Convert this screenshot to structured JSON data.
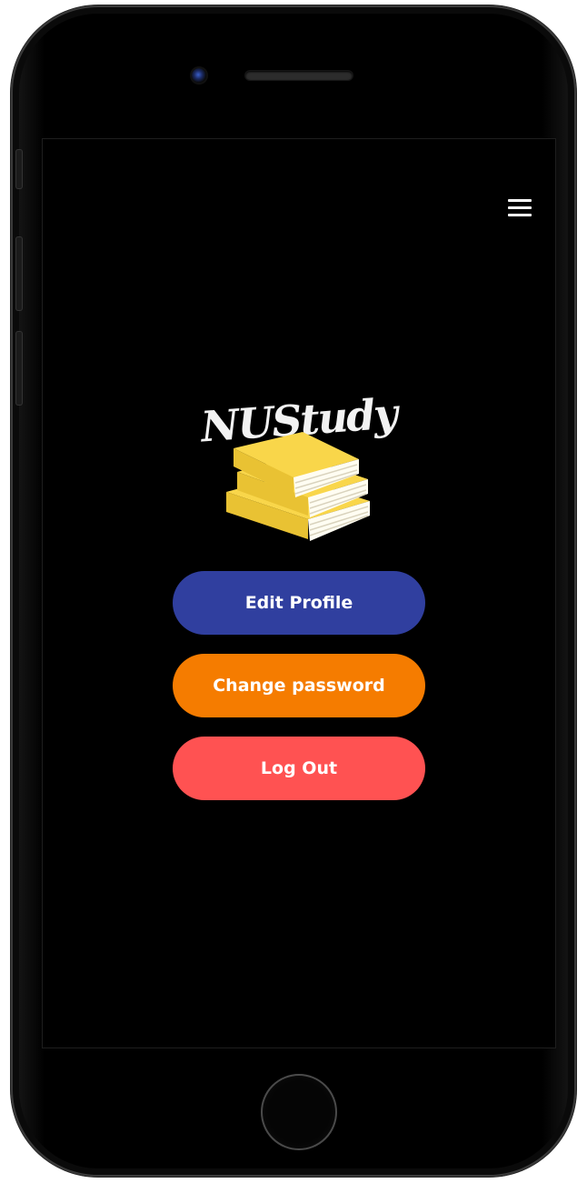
{
  "app": {
    "logo_text": "NUStudy"
  },
  "menu": {
    "icon": "hamburger-menu-icon"
  },
  "actions": {
    "edit_profile": {
      "label": "Edit Profile",
      "color": "#303F9F"
    },
    "change_password": {
      "label": "Change password",
      "color": "#F57C00"
    },
    "log_out": {
      "label": "Log Out",
      "color": "#FF5252"
    }
  },
  "theme": {
    "screen_background": "#000000",
    "book_color": "#F9D64A",
    "page_color": "#FFFDF2"
  }
}
